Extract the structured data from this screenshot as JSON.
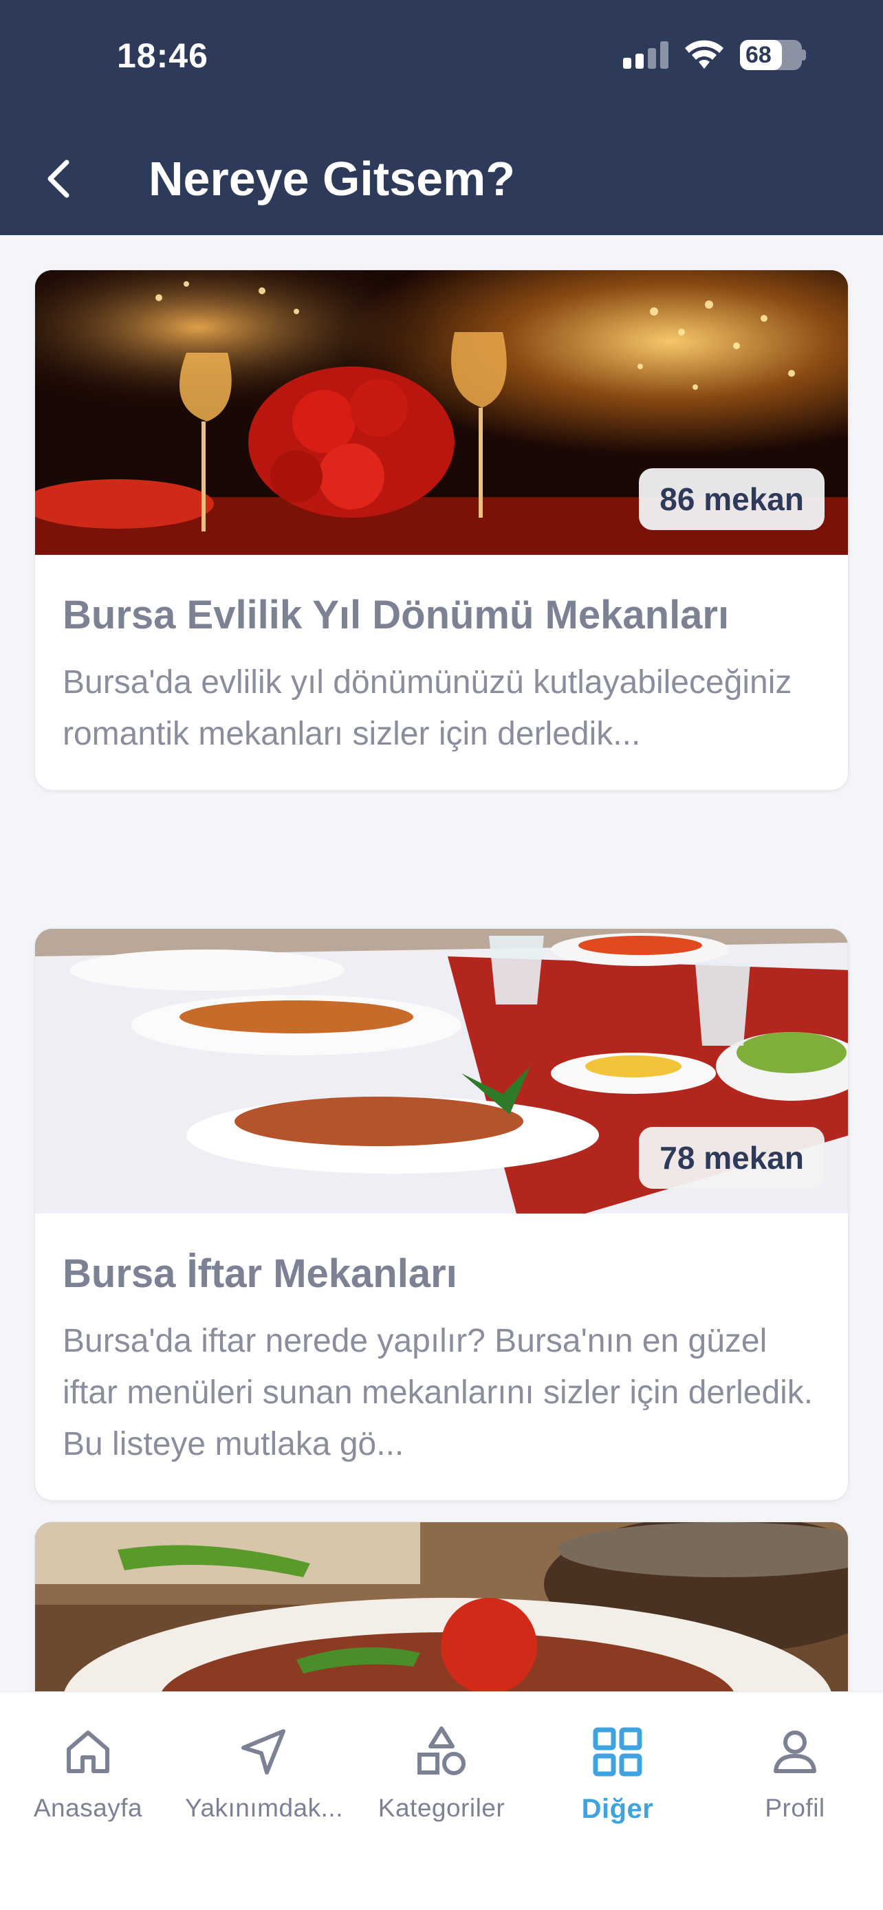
{
  "status": {
    "time": "18:46",
    "battery": "68"
  },
  "header": {
    "title": "Nereye Gitsem?",
    "back_icon": "chevron-left-icon"
  },
  "cards": [
    {
      "badge": "86 mekan",
      "title": "Bursa Evlilik Yıl Dönümü Mekanları",
      "description": "Bursa'da evlilik yıl dönümünüzü kutlayabileceğiniz romantik mekanları sizler için derledik..."
    },
    {
      "badge": "78 mekan",
      "title": "Bursa İftar Mekanları",
      "description": "Bursa'da iftar nerede yapılır? Bursa'nın en güzel iftar menüleri sunan mekanlarını sizler için derledik. Bu listeye mutlaka gö..."
    }
  ],
  "nav": {
    "items": [
      {
        "label": "Anasayfa",
        "icon": "home-icon"
      },
      {
        "label": "Yakınımdak...",
        "icon": "navigation-icon"
      },
      {
        "label": "Kategoriler",
        "icon": "shapes-icon"
      },
      {
        "label": "Diğer",
        "icon": "grid-icon",
        "active": true
      },
      {
        "label": "Profil",
        "icon": "user-icon"
      }
    ],
    "active_color": "#3fa3e0",
    "inactive_color": "#7c8194"
  },
  "colors": {
    "header_bg": "#2d3a5a",
    "page_bg": "#f4f5f9"
  }
}
